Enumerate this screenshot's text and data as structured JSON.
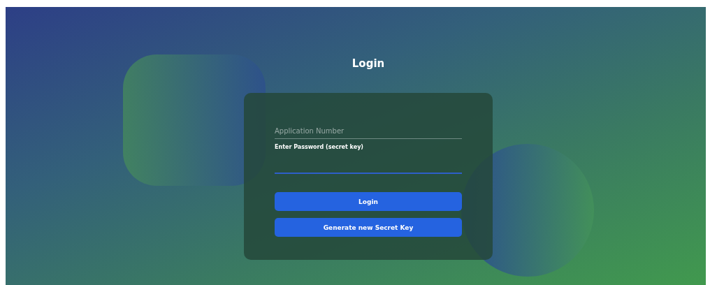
{
  "title": "Login",
  "fields": [
    {
      "placeholder": "Application Number",
      "focused": false
    },
    {
      "label": "Enter Password (secret key)",
      "focused": true
    }
  ],
  "buttons": [
    "Login",
    "Generate new Secret Key"
  ]
}
